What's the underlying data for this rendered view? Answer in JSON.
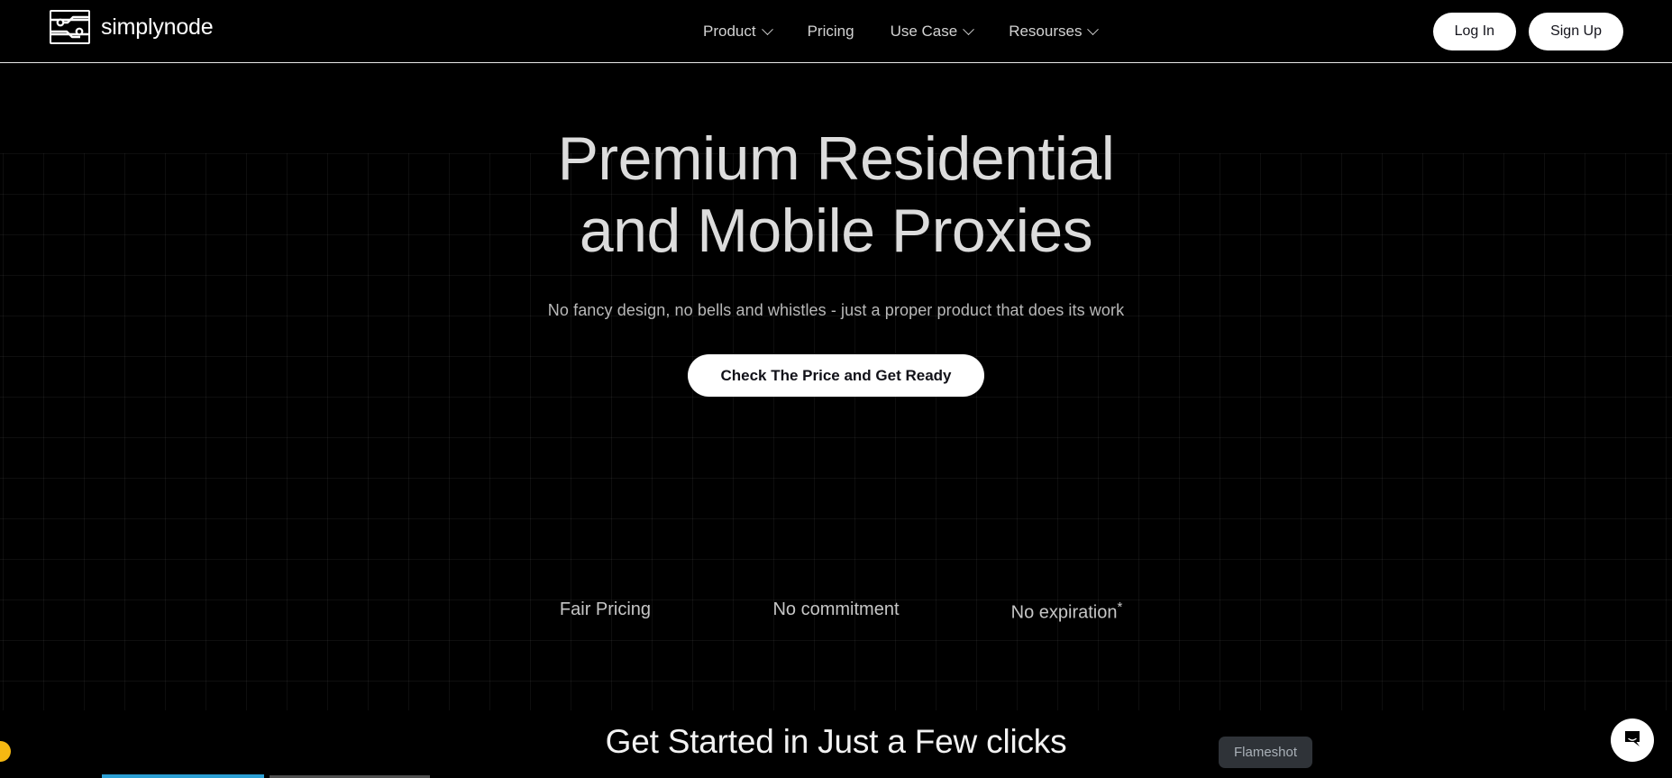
{
  "header": {
    "brand_name": "simplynode",
    "brand_icon": "simplynode-node-logo-icon",
    "nav": [
      {
        "label": "Product",
        "has_dropdown": true,
        "icon": "chevron-down-icon"
      },
      {
        "label": "Pricing",
        "has_dropdown": false,
        "icon": ""
      },
      {
        "label": "Use Case",
        "has_dropdown": true,
        "icon": "chevron-down-icon"
      },
      {
        "label": "Resourses",
        "has_dropdown": true,
        "icon": "chevron-down-icon"
      }
    ],
    "login_label": "Log In",
    "signup_label": "Sign Up"
  },
  "hero": {
    "title_line1": "Premium Residential",
    "title_line2": "and Mobile Proxies",
    "subtitle": "No fancy design, no bells and whistles - just a proper product that does its work",
    "cta_label": "Check The Price and Get Ready",
    "features": [
      {
        "label": "Fair Pricing",
        "superscript": ""
      },
      {
        "label": "No commitment",
        "superscript": ""
      },
      {
        "label": "No expiration",
        "superscript": "*"
      }
    ]
  },
  "section2": {
    "title": "Get Started in Just a Few clicks"
  },
  "overlays": {
    "flameshot_label": "Flameshot",
    "chat_icon": "chat-bubble-icon",
    "corner_dot_icon": "yellow-circle-indicator"
  },
  "colors": {
    "background": "#000000",
    "text_primary": "#dcdcdc",
    "text_secondary": "#b9b9b9",
    "button_bg": "#ffffff",
    "button_text": "#14141c",
    "tooltip_bg": "#2f3338",
    "tooltip_text": "#a9b0b7",
    "accent_yellow": "#f5b812",
    "accent_cyan": "#2b9fd4"
  }
}
